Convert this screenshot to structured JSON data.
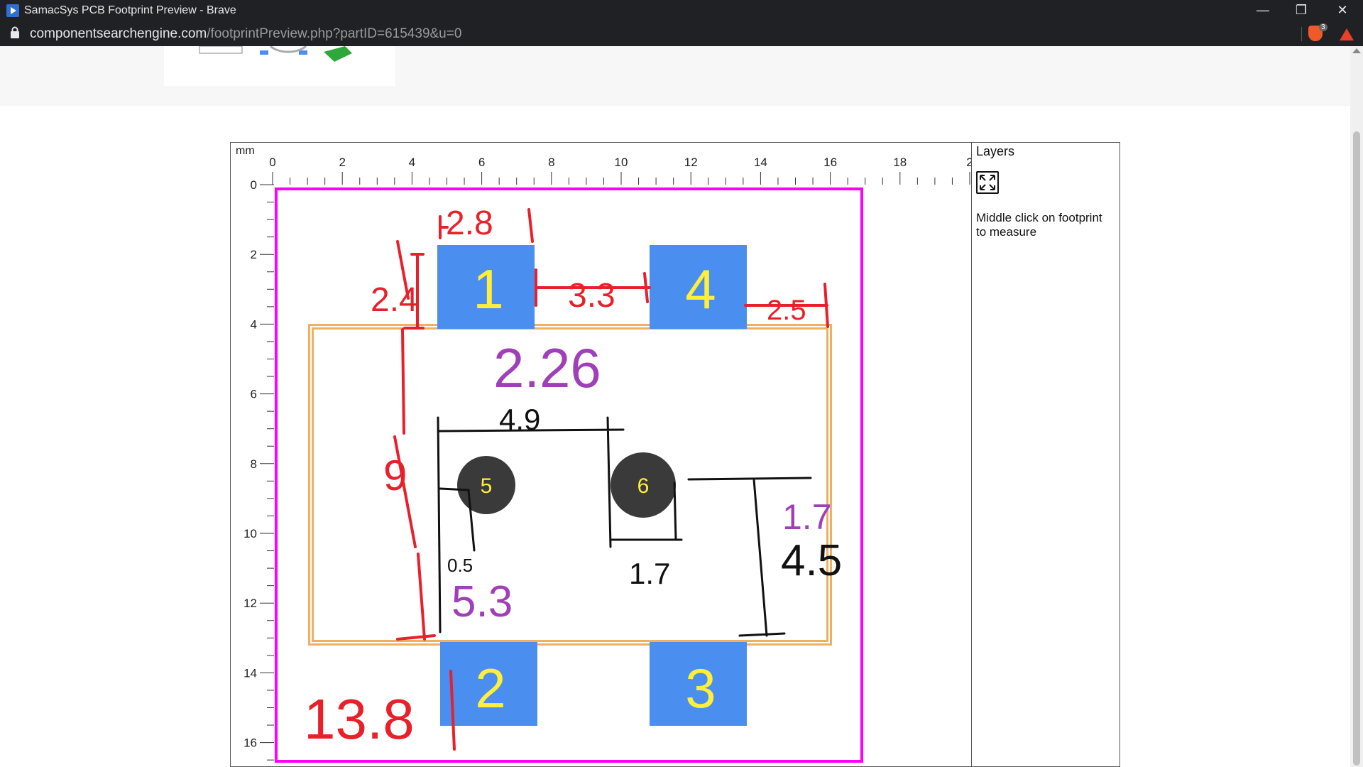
{
  "window": {
    "title": "SamacSys PCB Footprint Preview - Brave",
    "minimize_glyph": "—",
    "restore_glyph": "❐",
    "close_glyph": "✕"
  },
  "address_bar": {
    "domain": "componentsearchengine.com",
    "path": "/footprintPreview.php?partID=615439&u=0",
    "shield_count": "3"
  },
  "viewer": {
    "unit_label": "mm",
    "x_ticks": [
      "0",
      "2",
      "4",
      "6",
      "8",
      "10",
      "12",
      "14",
      "16",
      "18",
      "2"
    ],
    "y_ticks": [
      "0",
      "2",
      "4",
      "6",
      "8",
      "10",
      "12",
      "14",
      "16"
    ]
  },
  "pads": [
    {
      "label": "1"
    },
    {
      "label": "4"
    },
    {
      "label": "2"
    },
    {
      "label": "3"
    }
  ],
  "holes": [
    {
      "label": "5"
    },
    {
      "label": "6"
    }
  ],
  "layers_panel": {
    "heading": "Layers",
    "expand_icon": "expand-arrows-icon",
    "hint": "Middle click on footprint to measure"
  },
  "colors": {
    "pad": "#4a8ef0",
    "pad_text": "#ffef3a",
    "hole": "#3a3a3a",
    "outline_magenta": "#ff00ff",
    "body_outline": "#f5a623",
    "annotation_red": "#e8202a",
    "annotation_purple": "#a040b8",
    "annotation_black": "#111111"
  },
  "annotations": {
    "red": [
      "2.8",
      "2.4",
      "3.3",
      "2.5",
      "9",
      "13.8"
    ],
    "purple": [
      "2.26",
      "5.3",
      "1.7"
    ],
    "black": [
      "4.9",
      "0.5",
      "1.7",
      "4.5"
    ]
  }
}
